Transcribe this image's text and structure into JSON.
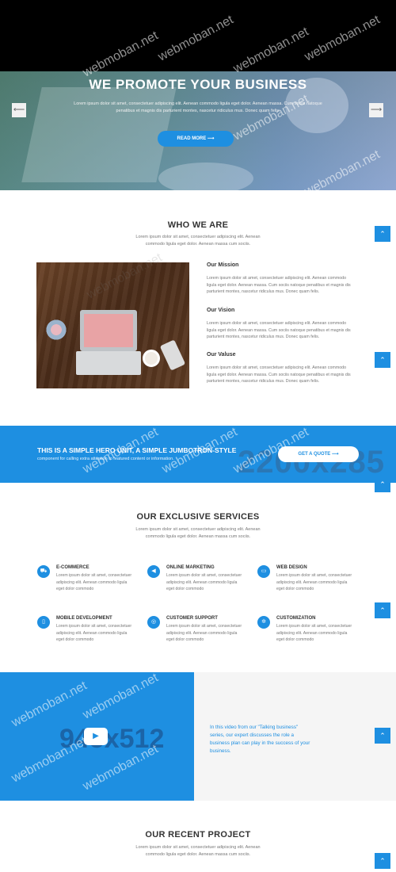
{
  "hero": {
    "title": "WE PROMOTE YOUR BUSINESS",
    "subtitle": "Lorem ipsum dolor sit amet, consectetuer adipiscing elit. Aenean commodo ligula eget dolor. Aenean massa. Cum sociis natoque penatibus et magnis dis parturient montes, nascetur ridiculus mus. Donec quam felis.",
    "cta": "READ MORE ⟶",
    "prev_icon": "⟵",
    "next_icon": "⟶"
  },
  "about": {
    "title": "WHO WE ARE",
    "subtitle": "Lorem ipsum dolor sit amet, consectetuer adipiscing elit. Aenean commodo ligula eget dolor. Aenean massa cum sociis.",
    "items": [
      {
        "title": "Our Mission",
        "text": "Lorem ipsum dolor sit amet, consectetuer adipiscing elit. Aenean commodo ligula eget dolor. Aenean massa. Cum sociis natoque penatibus et magnis dis parturient montes, nascetur ridiculus mus. Donec quam felis."
      },
      {
        "title": "Our Vision",
        "text": "Lorem ipsum dolor sit amet, consectetuer adipiscing elit. Aenean commodo ligula eget dolor. Aenean massa. Cum sociis natoque penatibus et magnis dis parturient montes, nascetur ridiculus mus. Donec quam felis."
      },
      {
        "title": "Our Valuse",
        "text": "Lorem ipsum dolor sit amet, consectetuer adipiscing elit. Aenean commodo ligula eget dolor. Aenean massa. Cum sociis natoque penatibus et magnis dis parturient montes, nascetur ridiculus mus. Donec quam felis."
      }
    ]
  },
  "jumbotron": {
    "title": "THIS IS A SIMPLE HERO UNIT, A SIMPLE JUMBOTRON-STYLE",
    "text": "component for calling extra attention to featured content or information.",
    "button": "GET A QUOTE ⟶",
    "placeholder": "2200x285"
  },
  "services": {
    "title": "OUR EXCLUSIVE SERVICES",
    "subtitle": "Lorem ipsum dolor sit amet, consectetuer adipiscing elit. Aenean commodo ligula eget dolor. Aenean massa cum sociis.",
    "items": [
      {
        "title": "E-COMMERCE",
        "icon": "cart-icon",
        "glyph": "⛟",
        "text": "Lorem ipsum dolor sit amet, consectetuer adipiscing elit. Aenean commodo ligula eget dolor commodo"
      },
      {
        "title": "ONLINE MARKETING",
        "icon": "megaphone-icon",
        "glyph": "◀",
        "text": "Lorem ipsum dolor sit amet, consectetuer adipiscing elit. Aenean commodo ligula eget dolor commodo"
      },
      {
        "title": "WEB DESIGN",
        "icon": "monitor-icon",
        "glyph": "▭",
        "text": "Lorem ipsum dolor sit amet, consectetuer adipiscing elit. Aenean commodo ligula eget dolor commodo"
      },
      {
        "title": "MOBILE DEVELOPMENT",
        "icon": "mobile-icon",
        "glyph": "▯",
        "text": "Lorem ipsum dolor sit amet, consectetuer adipiscing elit. Aenean commodo ligula eget dolor commodo"
      },
      {
        "title": "CUSTOMER SUPPORT",
        "icon": "support-icon",
        "glyph": "◎",
        "text": "Lorem ipsum dolor sit amet, consectetuer adipiscing elit. Aenean commodo ligula eget dolor commodo"
      },
      {
        "title": "CUSTOMIZATION",
        "icon": "gear-icon",
        "glyph": "✲",
        "text": "Lorem ipsum dolor sit amet, consectetuer adipiscing elit. Aenean commodo ligula eget dolor commodo"
      }
    ]
  },
  "video": {
    "placeholder": "945x512",
    "play_icon": "▶",
    "text": "In this video from our \"Talking business\" series, our expert discusses the role a business plan can play in the success of your business."
  },
  "projects": {
    "title": "OUR RECENT PROJECT",
    "subtitle": "Lorem ipsum dolor sit amet, consectetuer adipiscing elit. Aenean commodo ligula eget dolor. Aenean massa cum sociis."
  },
  "side_tab_icon": "⌃",
  "watermark": "webmoban.net",
  "colors": {
    "accent": "#1e8fe1",
    "topbar": "#000000"
  }
}
